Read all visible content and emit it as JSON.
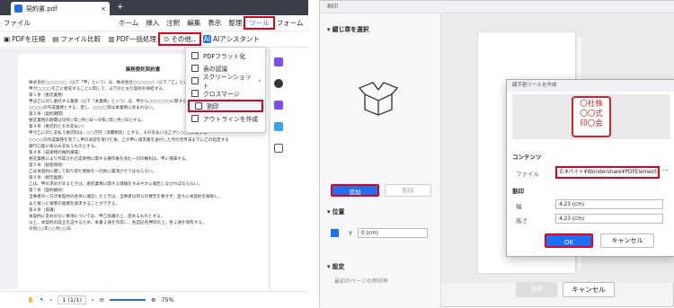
{
  "left_app": {
    "tab_title": "契約書.pdf",
    "menu": {
      "file": "ファイル",
      "home": "ホーム",
      "insert": "挿入",
      "annotate": "注釈",
      "edit": "編集",
      "display": "表示",
      "organize": "整理",
      "tool": "ツール",
      "form": "フォーム"
    },
    "toolbar": {
      "pdf_compress": "PDFを圧縮",
      "file_compare": "ファイル比較",
      "batch": "PDF一括処理",
      "other": "その他..",
      "ai": "AIアシスタント"
    },
    "dropdown": [
      "PDFフラット化",
      "表の認識",
      "スクリーンショット",
      "クロスマージ",
      "割印",
      "アウトラインを作成"
    ],
    "doc": {
      "title": "業務委託契約書",
      "lines": [
        "株式会社○○○○○○（以下「甲」という）は、株式会社○○○○○○（以下「乙」という）と、",
        "甲が○○○○を乙に委託することに関して、以下のとおり契約を締結する。",
        "第１条（委託業務）",
        "甲は乙に対し委託する業務（以下「本業務」という）は、甲から○○○○○○に関する",
        "○○○○の作成業務とする。但し、○○○○等は本業務に含まれない。",
        "第２条（契約期間）",
        "委託業務の期間は令和○年○月○日～令和○年○月○日とする。",
        "第３条（委託料とその支払い）",
        "甲が乙に対し支払う委託料は、○○万円（消費税別）とする。その支払いは乙が○○○○に関する",
        "○○○○の作成業務を完了し甲の承認を受けた後、乙が甲に請求書を送付した月の翌月末までに乙の指定する",
        "銀行口座に振込み支払うものとする。",
        "第４条（成果物の権利帰属）",
        "委託業務により作成された成果物に関する著作権を含む一切の権利は、甲に帰属する。",
        "第５条（秘密保持）",
        "乙は本契約に関して知り得た情報を一切他に漏洩させてはならない。",
        "第６条（報告義務）",
        "乙は、甲の求めがあるときは、委託業務に関する情報をすみやかに報告しなければならない。",
        "第７条（契約解除）",
        "当事者の一方が本契約の各条に違反したときは、当事者は何らの催告を要せず、直ちに本契約を解除し、",
        "また被った損害の賠償を請求することができる。",
        "第８条（協議）",
        "本契約に定めのない事項については、甲乙協議の上、定めるものとする。",
        "以上、本契約の成立を証するため、本書２通を作成し、各自記名押印の上、各１通を保有する。",
        "令和○○年○○月○○日"
      ]
    },
    "status": {
      "page": "1 (1/1)",
      "zoom": "75%"
    }
  },
  "dialog": {
    "title": "割印",
    "section_select": "綴じ章を選択",
    "add": "追加",
    "delete": "削除",
    "section_position": "位置",
    "y_label": "Y",
    "y_value": "0 (cm)",
    "section_settings": "設定",
    "last_page": "最初のページの押印率",
    "apply": "適用",
    "cancel": "キャンセル"
  },
  "subdialog": {
    "title": "綴手割ツールを作成",
    "seal_text": [
      "〇社株",
      "〇〇式",
      "印〇会"
    ],
    "contents": "コンテンツ",
    "file_label": "ファイル",
    "file_value": "E:¥パイト¥Wondershare¥PDFElement",
    "stamp": "割印",
    "width_label": "幅",
    "width_value": "4.23 (cm)",
    "height_label": "高さ",
    "height_value": "4.23 (cm)",
    "ok": "OK",
    "cancel": "キャンセル"
  },
  "colors": {
    "accent": "#1f6ff2",
    "highlight": "#e0001b",
    "seal": "#d6222a"
  }
}
